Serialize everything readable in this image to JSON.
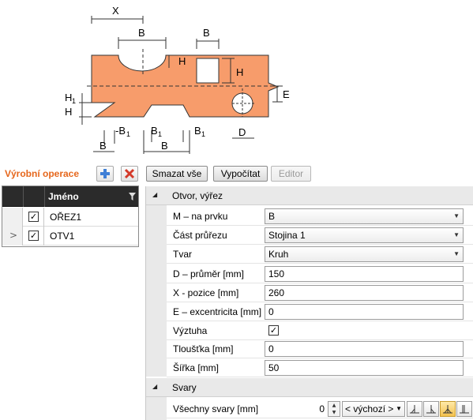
{
  "diagram": {
    "labels": {
      "x": "X",
      "b_top_cut": "B",
      "b_top_right": "B",
      "h_cut": "H",
      "h_square": "H",
      "e": "E",
      "h1_left": "H",
      "h1_sub": "1",
      "h_left": "H",
      "neg_b1": "-B",
      "neg_b1_sub": "1",
      "b1_mid": "B",
      "b1_mid_sub": "1",
      "b1_right": "B",
      "b1_right_sub": "1",
      "d": "D",
      "b_bottom_left": "B",
      "b_bottom_mid": "B"
    },
    "fill_color": "#f79c6b"
  },
  "toolbar": {
    "title": "Výrobní operace",
    "add_icon": "plus-icon",
    "delete_icon": "delete-x-icon",
    "delete_all_label": "Smazat vše",
    "calculate_label": "Vypočítat",
    "editor_label": "Editor"
  },
  "operations": {
    "column_name": "Jméno",
    "rows": [
      {
        "name": "OŘEZ1",
        "checked": true,
        "current": false
      },
      {
        "name": "OTV1",
        "checked": true,
        "current": true
      }
    ]
  },
  "properties": {
    "section1_title": "Otvor, výřez",
    "rows": {
      "member": {
        "label": "M – na prvku",
        "value": "B"
      },
      "part": {
        "label": "Část průřezu",
        "value": "Stojina 1"
      },
      "shape": {
        "label": "Tvar",
        "value": "Kruh"
      },
      "diameter": {
        "label": "D – průměr [mm]",
        "value": "150"
      },
      "x_pos": {
        "label": "X - pozice [mm]",
        "value": "260"
      },
      "ecc": {
        "label": "E – excentricita [mm]",
        "value": "0"
      },
      "stiff": {
        "label": "Výztuha",
        "checked": true
      },
      "thick": {
        "label": "Tloušťka [mm]",
        "value": "0"
      },
      "width": {
        "label": "Šířka [mm]",
        "value": "50"
      }
    },
    "section2_title": "Svary",
    "weld": {
      "label": "Všechny svary [mm]",
      "value": "0",
      "preset": "< výchozí >"
    }
  },
  "colors": {
    "accent": "#e6671c",
    "grid_header": "#2b2b2b",
    "active_weld": "#f4c24f"
  }
}
